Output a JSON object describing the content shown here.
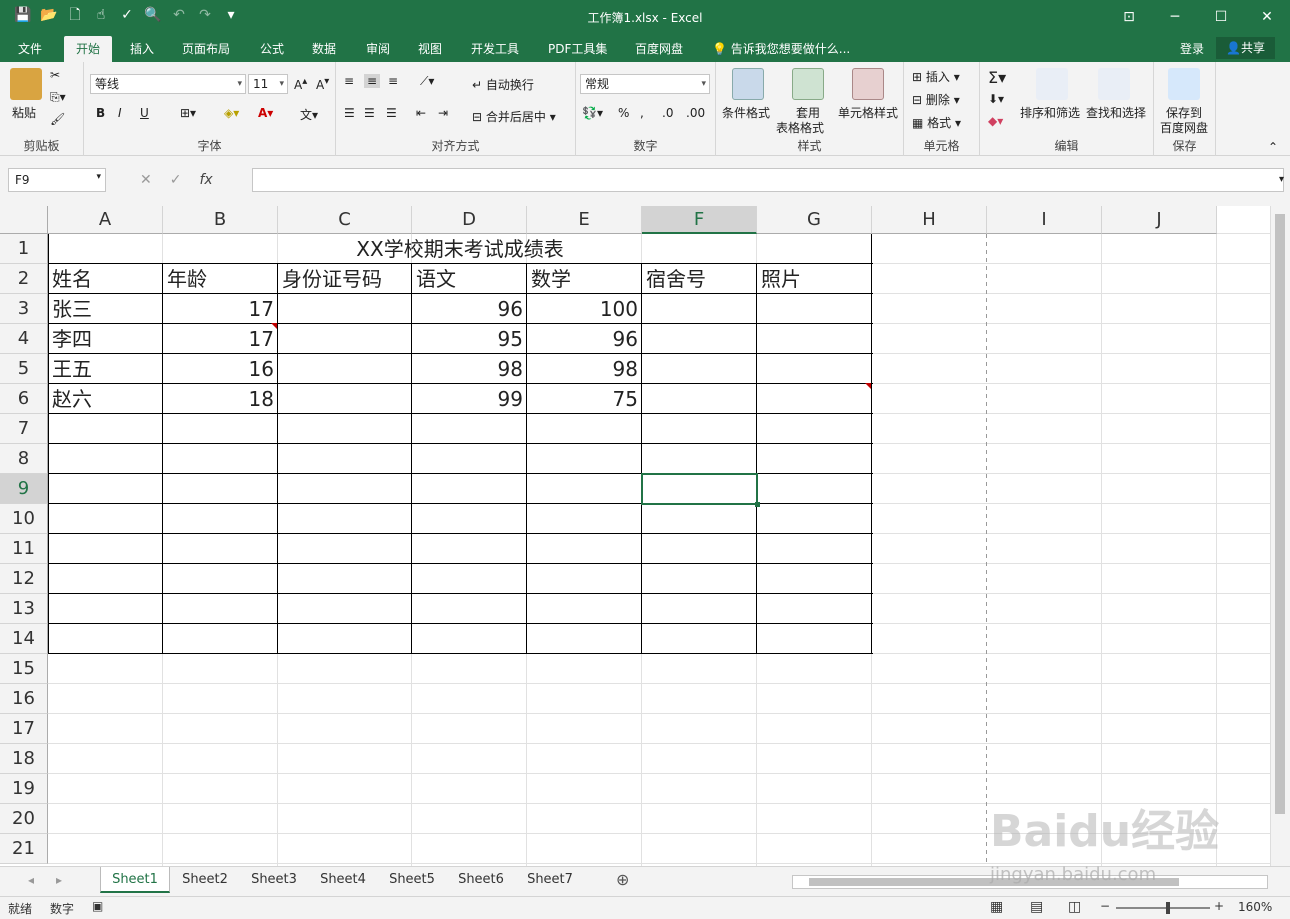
{
  "window": {
    "title": "工作簿1.xlsx - Excel"
  },
  "menu": {
    "tabs": [
      "文件",
      "开始",
      "插入",
      "页面布局",
      "公式",
      "数据",
      "审阅",
      "视图",
      "开发工具",
      "PDF工具集",
      "百度网盘"
    ],
    "tellme": "告诉我您想要做什么...",
    "login": "登录",
    "share": "共享"
  },
  "ribbon": {
    "clipboard": {
      "label": "剪贴板",
      "paste": "粘贴"
    },
    "font": {
      "label": "字体",
      "name": "等线",
      "size": "11",
      "bold": "B",
      "italic": "I",
      "underline": "U"
    },
    "alignment": {
      "label": "对齐方式",
      "wrap": "自动换行",
      "merge": "合并后居中"
    },
    "number": {
      "label": "数字",
      "format": "常规"
    },
    "styles": {
      "label": "样式",
      "conditional": "条件格式",
      "table_l1": "套用",
      "table_l2": "表格格式",
      "cell_styles": "单元格样式"
    },
    "cells": {
      "label": "单元格",
      "insert": "插入",
      "delete": "删除",
      "format": "格式"
    },
    "editing": {
      "label": "编辑",
      "sort": "排序和筛选",
      "find": "查找和选择"
    },
    "save": {
      "label": "保存",
      "btn_l1": "保存到",
      "btn_l2": "百度网盘"
    }
  },
  "formula": {
    "namebox": "F9",
    "fx": "fx",
    "value": ""
  },
  "grid": {
    "columns": [
      "A",
      "B",
      "C",
      "D",
      "E",
      "F",
      "G",
      "H",
      "I",
      "J"
    ],
    "rows": [
      "1",
      "2",
      "3",
      "4",
      "5",
      "6",
      "7",
      "8",
      "9",
      "10",
      "11",
      "12",
      "13",
      "14",
      "15",
      "16",
      "17",
      "18",
      "19",
      "20",
      "21"
    ],
    "title": "XX学校期末考试成绩表",
    "headers": [
      "姓名",
      "年龄",
      "身份证号码",
      "语文",
      "数学",
      "宿舍号",
      "照片"
    ],
    "data": [
      {
        "name": "张三",
        "age": "17",
        "id": "",
        "chinese": "96",
        "math": "100",
        "dorm": "",
        "photo": ""
      },
      {
        "name": "李四",
        "age": "17",
        "id": "",
        "chinese": "95",
        "math": "96",
        "dorm": "",
        "photo": ""
      },
      {
        "name": "王五",
        "age": "16",
        "id": "",
        "chinese": "98",
        "math": "98",
        "dorm": "",
        "photo": ""
      },
      {
        "name": "赵六",
        "age": "18",
        "id": "",
        "chinese": "99",
        "math": "75",
        "dorm": "",
        "photo": ""
      }
    ]
  },
  "sheets": [
    "Sheet1",
    "Sheet2",
    "Sheet3",
    "Sheet4",
    "Sheet5",
    "Sheet6",
    "Sheet7"
  ],
  "status": {
    "ready": "就绪",
    "mode": "数字",
    "zoom": "160%"
  },
  "watermark": {
    "logo": "Baidu经验",
    "url": "jingyan.baidu.com"
  }
}
